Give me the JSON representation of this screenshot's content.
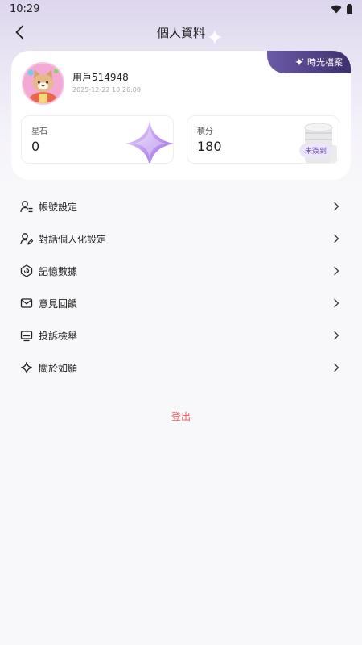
{
  "status_bar": {
    "time": "10:29"
  },
  "header": {
    "title": "個人資料"
  },
  "profile": {
    "username": "用戶514948",
    "timestamp": "2025-12-22 10:26:00",
    "tag_label": "時光檔案"
  },
  "stats": [
    {
      "label": "星石",
      "value": "0"
    },
    {
      "label": "積分",
      "value": "180",
      "badge": "未簽到"
    }
  ],
  "menu": [
    {
      "label": "帳號設定",
      "icon": "user-settings-icon"
    },
    {
      "label": "對話個人化設定",
      "icon": "user-edit-icon"
    },
    {
      "label": "記憶數據",
      "icon": "memory-icon"
    },
    {
      "label": "意見回饋",
      "icon": "mail-icon"
    },
    {
      "label": "投訴檢舉",
      "icon": "report-icon"
    },
    {
      "label": "關於如願",
      "icon": "sparkle-icon"
    }
  ],
  "logout_label": "登出",
  "colors": {
    "accent": "#6a4bb0",
    "logout": "#e55a5a",
    "tag_bg": "#4a3a80"
  }
}
